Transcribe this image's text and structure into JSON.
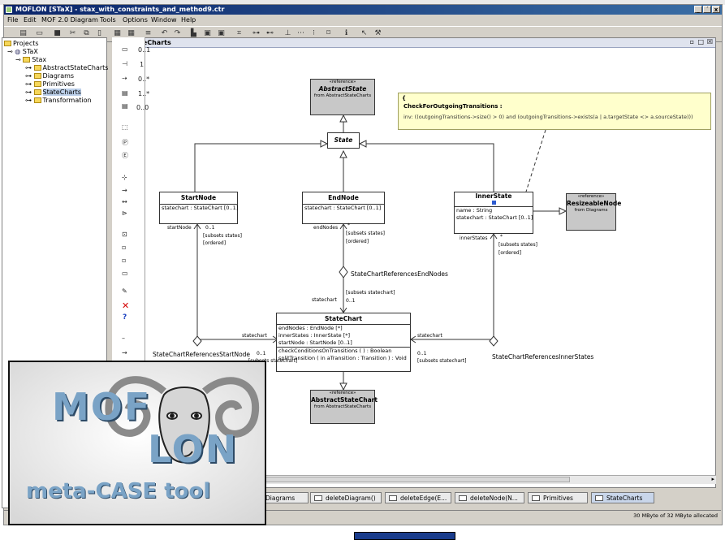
{
  "window": {
    "title": "MOFLON [STaX] - stax_with_constraints_and_method9.ctr",
    "controls": [
      "_",
      "´",
      "x"
    ]
  },
  "menu": [
    "File",
    "Edit",
    "MOF 2.0 Diagram",
    "Tools",
    "Options",
    "Window",
    "Help"
  ],
  "tree": {
    "root": "Projects",
    "project": "STaX",
    "package": "Stax",
    "items": [
      "AbstractStateCharts",
      "Diagrams",
      "Primitives",
      "StateCharts",
      "Transformation"
    ],
    "selected": "StateCharts"
  },
  "palette": [
    "0..1",
    "1",
    "0..*",
    "1..*",
    "0..0"
  ],
  "editor": {
    "tab_title": "StateCharts"
  },
  "diagram": {
    "classes": {
      "abstract_state": {
        "stereotype": "«reference»",
        "name": "AbstractState",
        "from": "from AbstractStateCharts"
      },
      "state": {
        "name": "State"
      },
      "start_node": {
        "name": "StartNode",
        "attrs": [
          "statechart : StateChart [0..1]"
        ]
      },
      "end_node": {
        "name": "EndNode",
        "attrs": [
          "statechart : StateChart [0..1]"
        ]
      },
      "inner_state": {
        "name": "InnerState",
        "attrs": [
          "name : String",
          "statechart : StateChart [0..1]"
        ]
      },
      "resizeable_node": {
        "stereotype": "«reference»",
        "name": "ResizeableNode",
        "from": "from Diagrams"
      },
      "state_chart": {
        "name": "StateChart",
        "attrs": [
          "endNodes : EndNode [*]",
          "innerStates : InnerState [*]",
          "startNode : StartNode [0..1]"
        ],
        "ops": [
          "checkConditionsOnTransitions ( ) : Boolean",
          "splitTransition ( in aTransition : Transition ) : Void"
        ]
      },
      "abstract_state_chart": {
        "stereotype": "«reference»",
        "name": "AbstractStateChart",
        "from": "from AbstractStateCharts"
      }
    },
    "constraint": {
      "bracket": "{",
      "name": "CheckForOutgoingTransitions :",
      "body": "inv: ((outgoingTransitions->size() > 0) and (outgoingTransitions->exists(a | a.targetState <> a.sourceState)))"
    },
    "associations": {
      "start": "StateChartReferencesStartNode",
      "end": "StateChartReferencesEndNodes",
      "inner": "StateChartReferencesInnerStates"
    },
    "labels": {
      "startNode": "startNode",
      "mult_01": "0..1",
      "subsets_states": "[subsets states]",
      "ordered": "[ordered]",
      "endNodes": "endNodes",
      "star": "*",
      "statechart": "statechart",
      "subsets_statechart": "[subsets statechart]",
      "innerStates": "innerStates"
    }
  },
  "tabs": [
    "Diagrams",
    "deleteDiagram()",
    "deleteEdge(E...",
    "deleteNode(N...",
    "Primitives",
    "StateCharts"
  ],
  "status": {
    "memory": "30 MByte of 32 MByte allocated"
  },
  "logo": {
    "line1": "MOF",
    "line2": "LON",
    "tagline": "meta-CASE tool"
  }
}
